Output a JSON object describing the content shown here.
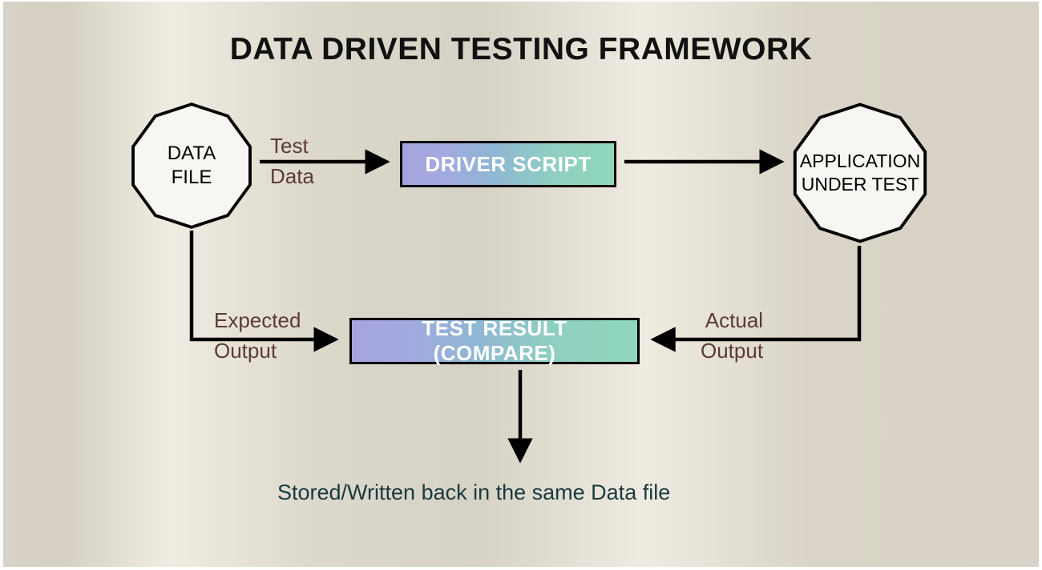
{
  "title": "DATA DRIVEN TESTING FRAMEWORK",
  "nodes": {
    "data_file": "DATA\nFILE",
    "driver_script": "DRIVER SCRIPT",
    "application_under_test": "APPLICATION\nUNDER TEST",
    "test_result_compare": "TEST RESULT (COMPARE)"
  },
  "edges": {
    "test_data": "Test\nData",
    "expected_output": "Expected\nOutput",
    "actual_output": "Actual\nOutput"
  },
  "footer_note": "Stored/Written back in the same Data file"
}
